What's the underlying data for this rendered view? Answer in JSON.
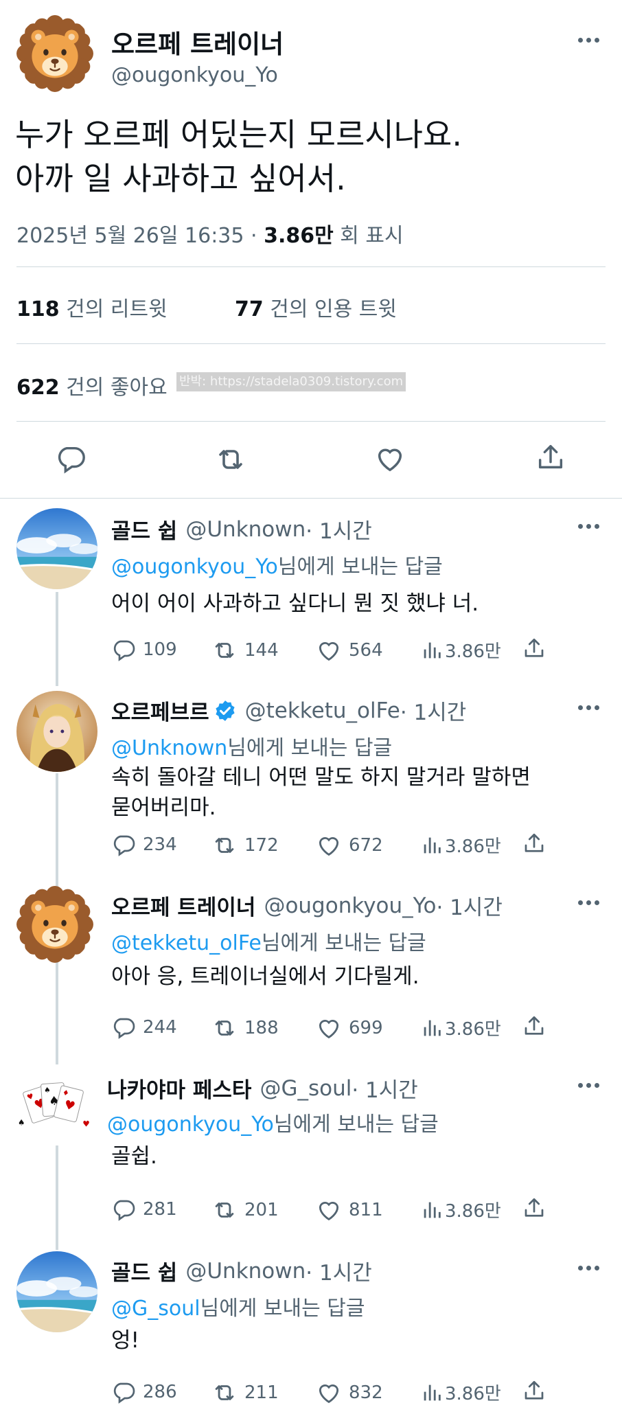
{
  "main_tweet": {
    "display_name": "오르페 트레이너",
    "handle": "@ougonkyou_Yo",
    "text_line1": "누가 오르페 어딨는지 모르시나요.",
    "text_line2": "아까 일 사과하고 싶어서.",
    "timestamp": "2025년 5월 26일 16:35 · ",
    "views_count": "3.86만",
    "views_label": " 회 표시",
    "retweets_count": "118",
    "retweets_label": " 건의 리트윗",
    "quotes_count": "77",
    "quotes_label": " 건의 인용 트윗",
    "likes_count": "622",
    "likes_label": " 건의 좋아요",
    "watermark": "반박: https://stadela0309.tistory.com"
  },
  "replies": [
    {
      "display_name": "골드 쉽",
      "handle": "@Unknown",
      "time": " · 1시간",
      "reply_to_handle": "@ougonkyou_Yo",
      "reply_to_suffix": "님에게 보내는 답글",
      "text": "어이 어이 사과하고 싶다니 뭔 짓 했냐 너.",
      "replies": "109",
      "retweets": "144",
      "likes": "564",
      "views": "3.86만",
      "verified": false
    },
    {
      "display_name": "오르페브르",
      "handle": "@tekketu_olFe",
      "time": " · 1시간",
      "reply_to_handle": "@Unknown",
      "reply_to_suffix": "님에게 보내는 답글",
      "text_line1": "속히 돌아갈 테니 어떤 말도 하지 말거라 말하면",
      "text_line2": "묻어버리마.",
      "replies": "234",
      "retweets": "172",
      "likes": "672",
      "views": "3.86만",
      "verified": true
    },
    {
      "display_name": "오르페 트레이너",
      "handle": "@ougonkyou_Yo",
      "time": " · 1시간",
      "reply_to_handle": "@tekketu_olFe",
      "reply_to_suffix": "님에게 보내는 답글",
      "text": "아아 응, 트레이너실에서 기다릴게.",
      "replies": "244",
      "retweets": "188",
      "likes": "699",
      "views": "3.86만",
      "verified": false
    },
    {
      "display_name": "나카야마 페스타",
      "handle": "@G_soul",
      "time": " · 1시간",
      "reply_to_handle": "@ougonkyou_Yo",
      "reply_to_suffix": "님에게 보내는 답글",
      "text": "골쉽.",
      "replies": "281",
      "retweets": "201",
      "likes": "811",
      "views": "3.86만",
      "verified": false
    },
    {
      "display_name": "골드 쉽",
      "handle": "@Unknown",
      "time": " · 1시간",
      "reply_to_handle": "@G_soul",
      "reply_to_suffix": "님에게 보내는 답글",
      "text": "엉!",
      "replies": "286",
      "retweets": "211",
      "likes": "832",
      "views": "3.86만",
      "verified": false
    }
  ],
  "icons": {
    "reply": "reply-icon",
    "retweet": "retweet-icon",
    "like": "heart-icon",
    "views": "views-icon",
    "share": "share-icon",
    "more": "more-icon",
    "verified": "verified-badge-icon"
  },
  "colors": {
    "accent": "#1d9bf0",
    "text": "#0f1419",
    "secondary": "#536471",
    "divider": "#cfd9de"
  }
}
